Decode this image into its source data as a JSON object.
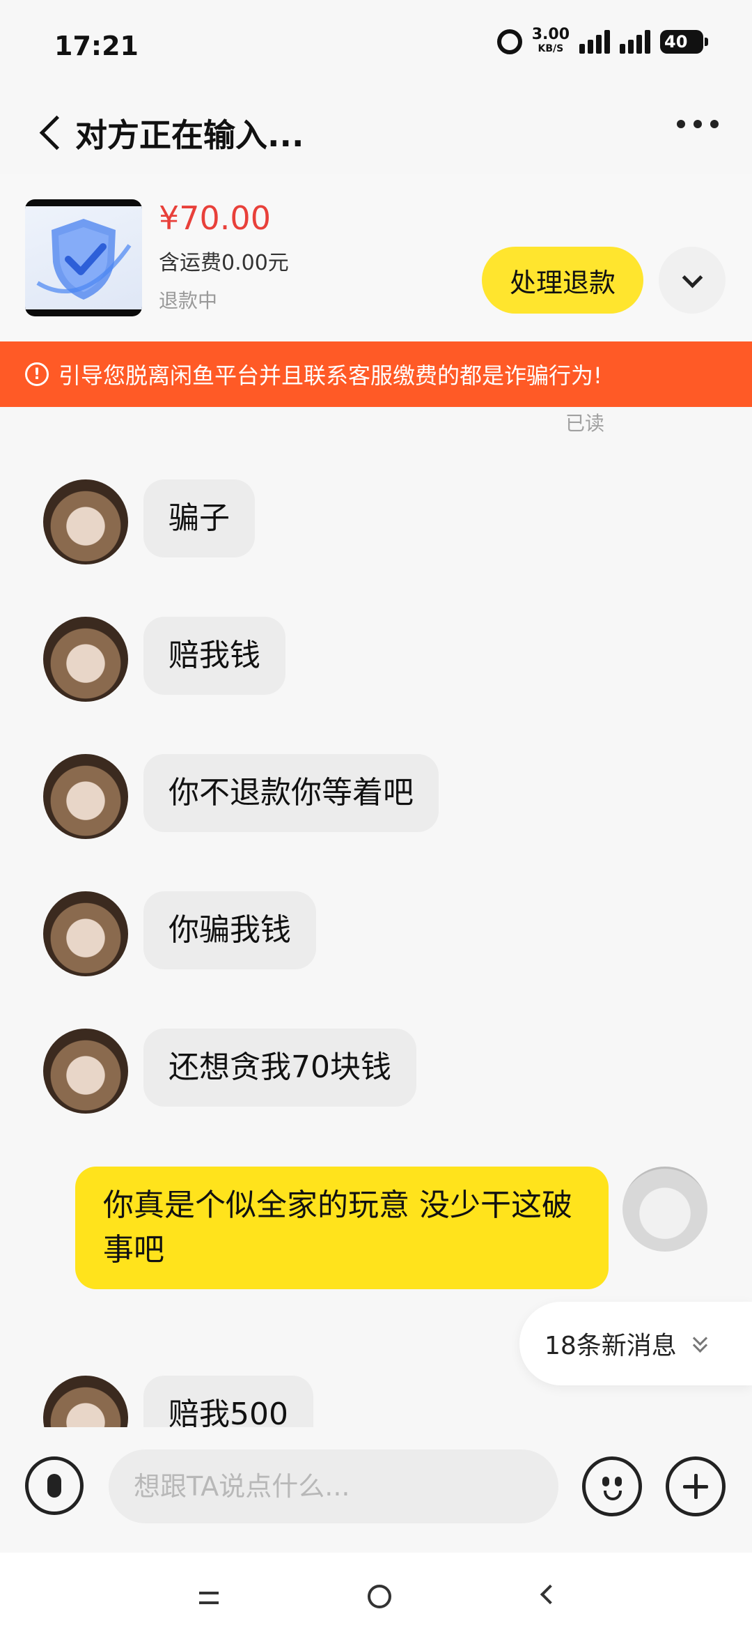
{
  "status_bar": {
    "time": "17:21",
    "net_speed": "3.00",
    "net_unit": "KB/S",
    "battery": "40"
  },
  "header": {
    "title": "对方正在输入..."
  },
  "order": {
    "price": "¥70.00",
    "shipping": "含运费0.00元",
    "status": "退款中",
    "action_label": "处理退款"
  },
  "warning": {
    "icon_text": "!",
    "text": "引导您脱离闲鱼平台并且联系客服缴费的都是诈骗行为!"
  },
  "chat": {
    "read_label": "已读",
    "messages": [
      {
        "from": "other",
        "text": "骗子"
      },
      {
        "from": "other",
        "text": "赔我钱"
      },
      {
        "from": "other",
        "text": "你不退款你等着吧"
      },
      {
        "from": "other",
        "text": "你骗我钱"
      },
      {
        "from": "other",
        "text": "还想贪我70块钱"
      },
      {
        "from": "self",
        "text": "你真是个似全家的玩意 没少干这破事吧"
      },
      {
        "from": "other",
        "text": "赔我500"
      }
    ],
    "new_messages_label": "18条新消息"
  },
  "input": {
    "placeholder": "想跟TA说点什么..."
  },
  "colors": {
    "accent_yellow": "#ffe31c",
    "price_red": "#e8403a",
    "warning_orange": "#ff5a26"
  }
}
